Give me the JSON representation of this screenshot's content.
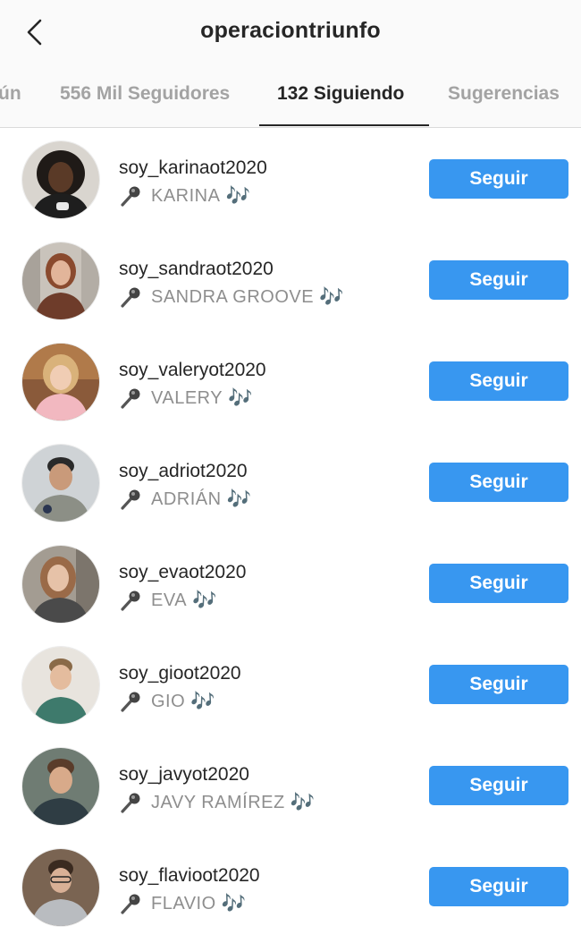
{
  "header": {
    "title": "operaciontriunfo"
  },
  "tabs": [
    {
      "label": "ún"
    },
    {
      "label": "556 Mil Seguidores"
    },
    {
      "label": "132 Siguiendo"
    },
    {
      "label": "Sugerencias"
    }
  ],
  "accounts": [
    {
      "username": "soy_karinaot2020",
      "name": "KARINA",
      "button": "Seguir"
    },
    {
      "username": "soy_sandraot2020",
      "name": "SANDRA GROOVE",
      "button": "Seguir"
    },
    {
      "username": "soy_valeryot2020",
      "name": "VALERY",
      "button": "Seguir"
    },
    {
      "username": "soy_adriot2020",
      "name": "ADRIÁN",
      "button": "Seguir"
    },
    {
      "username": "soy_evaot2020",
      "name": "EVA",
      "button": "Seguir"
    },
    {
      "username": "soy_gioot2020",
      "name": "GIO",
      "button": "Seguir"
    },
    {
      "username": "soy_javyot2020",
      "name": "JAVY RAMÍREZ",
      "button": "Seguir"
    },
    {
      "username": "soy_flavioot2020",
      "name": "FLAVIO",
      "button": "Seguir"
    }
  ],
  "decor": {
    "notes": "🎶",
    "accent": "#3897f0"
  }
}
